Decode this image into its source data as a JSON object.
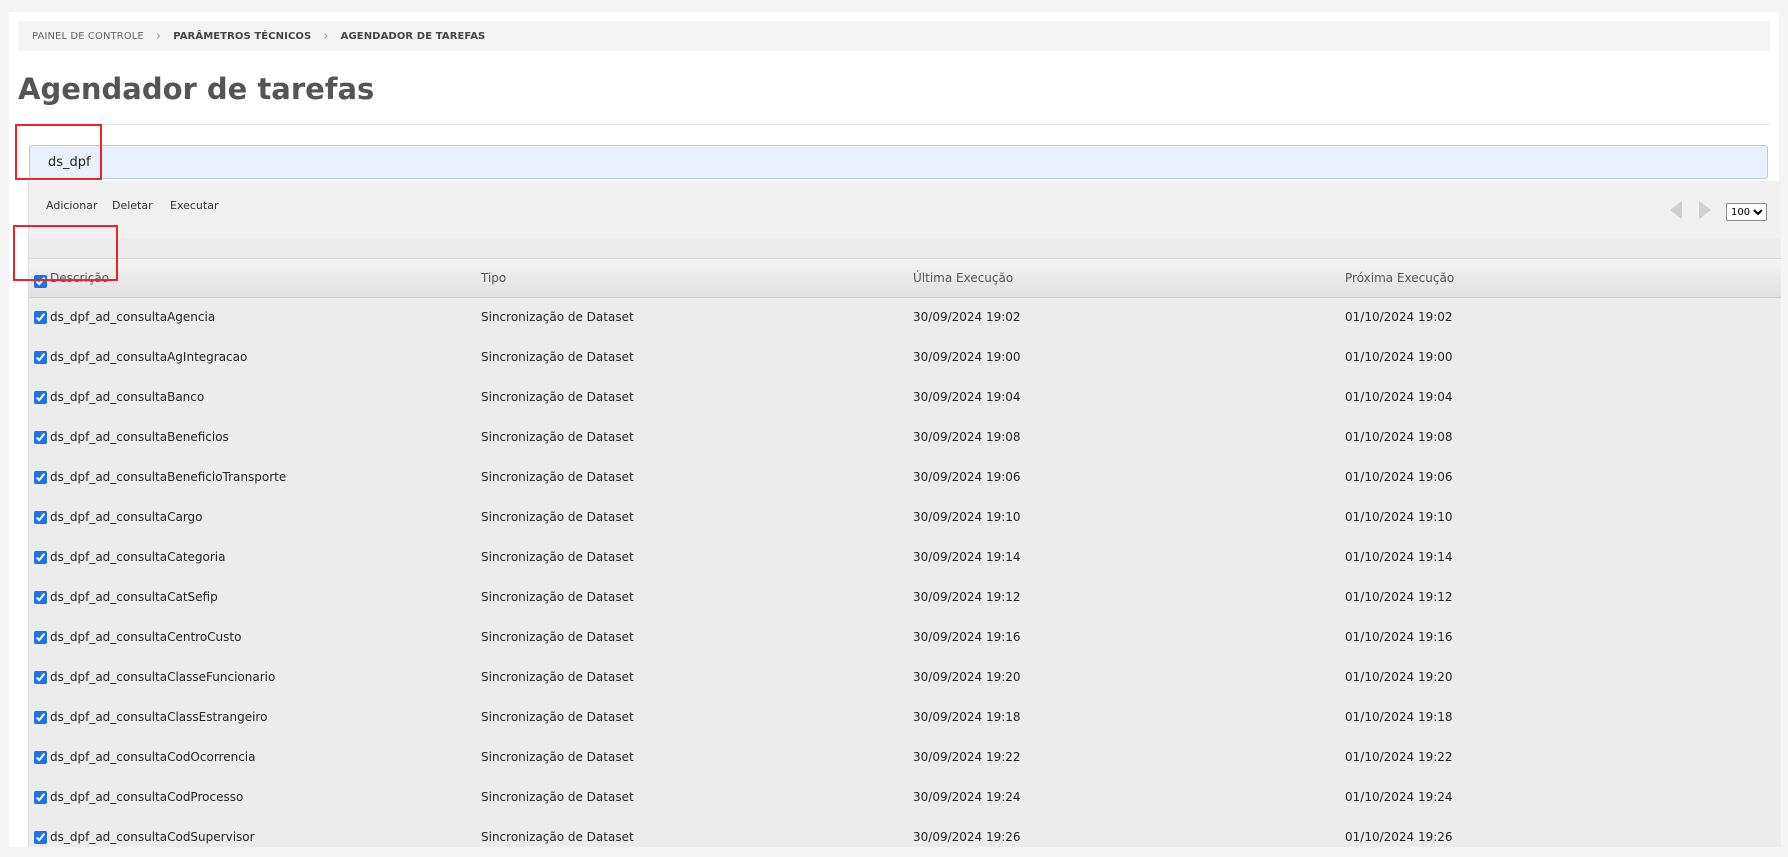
{
  "breadcrumb": {
    "items": [
      "PAINEL DE CONTROLE",
      "PARÂMETROS TÉCNICOS",
      "AGENDADOR DE TAREFAS"
    ]
  },
  "page": {
    "title": "Agendador de tarefas"
  },
  "search": {
    "value": "ds_dpf"
  },
  "toolbar": {
    "add_label": "Adicionar",
    "delete_label": "Deletar",
    "execute_label": "Executar",
    "page_size": "100"
  },
  "table": {
    "columns": [
      "Descrição",
      "Tipo",
      "Última Execução",
      "Próxima Execução"
    ],
    "rows": [
      {
        "descricao": "ds_dpf_ad_consultaAgencia",
        "tipo": "Sincronização de Dataset",
        "ultima": "30/09/2024 19:02",
        "proxima": "01/10/2024 19:02"
      },
      {
        "descricao": "ds_dpf_ad_consultaAgIntegracao",
        "tipo": "Sincronização de Dataset",
        "ultima": "30/09/2024 19:00",
        "proxima": "01/10/2024 19:00"
      },
      {
        "descricao": "ds_dpf_ad_consultaBanco",
        "tipo": "Sincronização de Dataset",
        "ultima": "30/09/2024 19:04",
        "proxima": "01/10/2024 19:04"
      },
      {
        "descricao": "ds_dpf_ad_consultaBeneficios",
        "tipo": "Sincronização de Dataset",
        "ultima": "30/09/2024 19:08",
        "proxima": "01/10/2024 19:08"
      },
      {
        "descricao": "ds_dpf_ad_consultaBeneficioTransporte",
        "tipo": "Sincronização de Dataset",
        "ultima": "30/09/2024 19:06",
        "proxima": "01/10/2024 19:06"
      },
      {
        "descricao": "ds_dpf_ad_consultaCargo",
        "tipo": "Sincronização de Dataset",
        "ultima": "30/09/2024 19:10",
        "proxima": "01/10/2024 19:10"
      },
      {
        "descricao": "ds_dpf_ad_consultaCategoria",
        "tipo": "Sincronização de Dataset",
        "ultima": "30/09/2024 19:14",
        "proxima": "01/10/2024 19:14"
      },
      {
        "descricao": "ds_dpf_ad_consultaCatSefip",
        "tipo": "Sincronização de Dataset",
        "ultima": "30/09/2024 19:12",
        "proxima": "01/10/2024 19:12"
      },
      {
        "descricao": "ds_dpf_ad_consultaCentroCusto",
        "tipo": "Sincronização de Dataset",
        "ultima": "30/09/2024 19:16",
        "proxima": "01/10/2024 19:16"
      },
      {
        "descricao": "ds_dpf_ad_consultaClasseFuncionario",
        "tipo": "Sincronização de Dataset",
        "ultima": "30/09/2024 19:20",
        "proxima": "01/10/2024 19:20"
      },
      {
        "descricao": "ds_dpf_ad_consultaClassEstrangeiro",
        "tipo": "Sincronização de Dataset",
        "ultima": "30/09/2024 19:18",
        "proxima": "01/10/2024 19:18"
      },
      {
        "descricao": "ds_dpf_ad_consultaCodOcorrencia",
        "tipo": "Sincronização de Dataset",
        "ultima": "30/09/2024 19:22",
        "proxima": "01/10/2024 19:22"
      },
      {
        "descricao": "ds_dpf_ad_consultaCodProcesso",
        "tipo": "Sincronização de Dataset",
        "ultima": "30/09/2024 19:24",
        "proxima": "01/10/2024 19:24"
      },
      {
        "descricao": "ds_dpf_ad_consultaCodSupervisor",
        "tipo": "Sincronização de Dataset",
        "ultima": "30/09/2024 19:26",
        "proxima": "01/10/2024 19:26"
      }
    ]
  },
  "colors": {
    "highlight": "#e8242c",
    "search_bg": "#e9f0fc",
    "grid_bg": "#ececec"
  }
}
